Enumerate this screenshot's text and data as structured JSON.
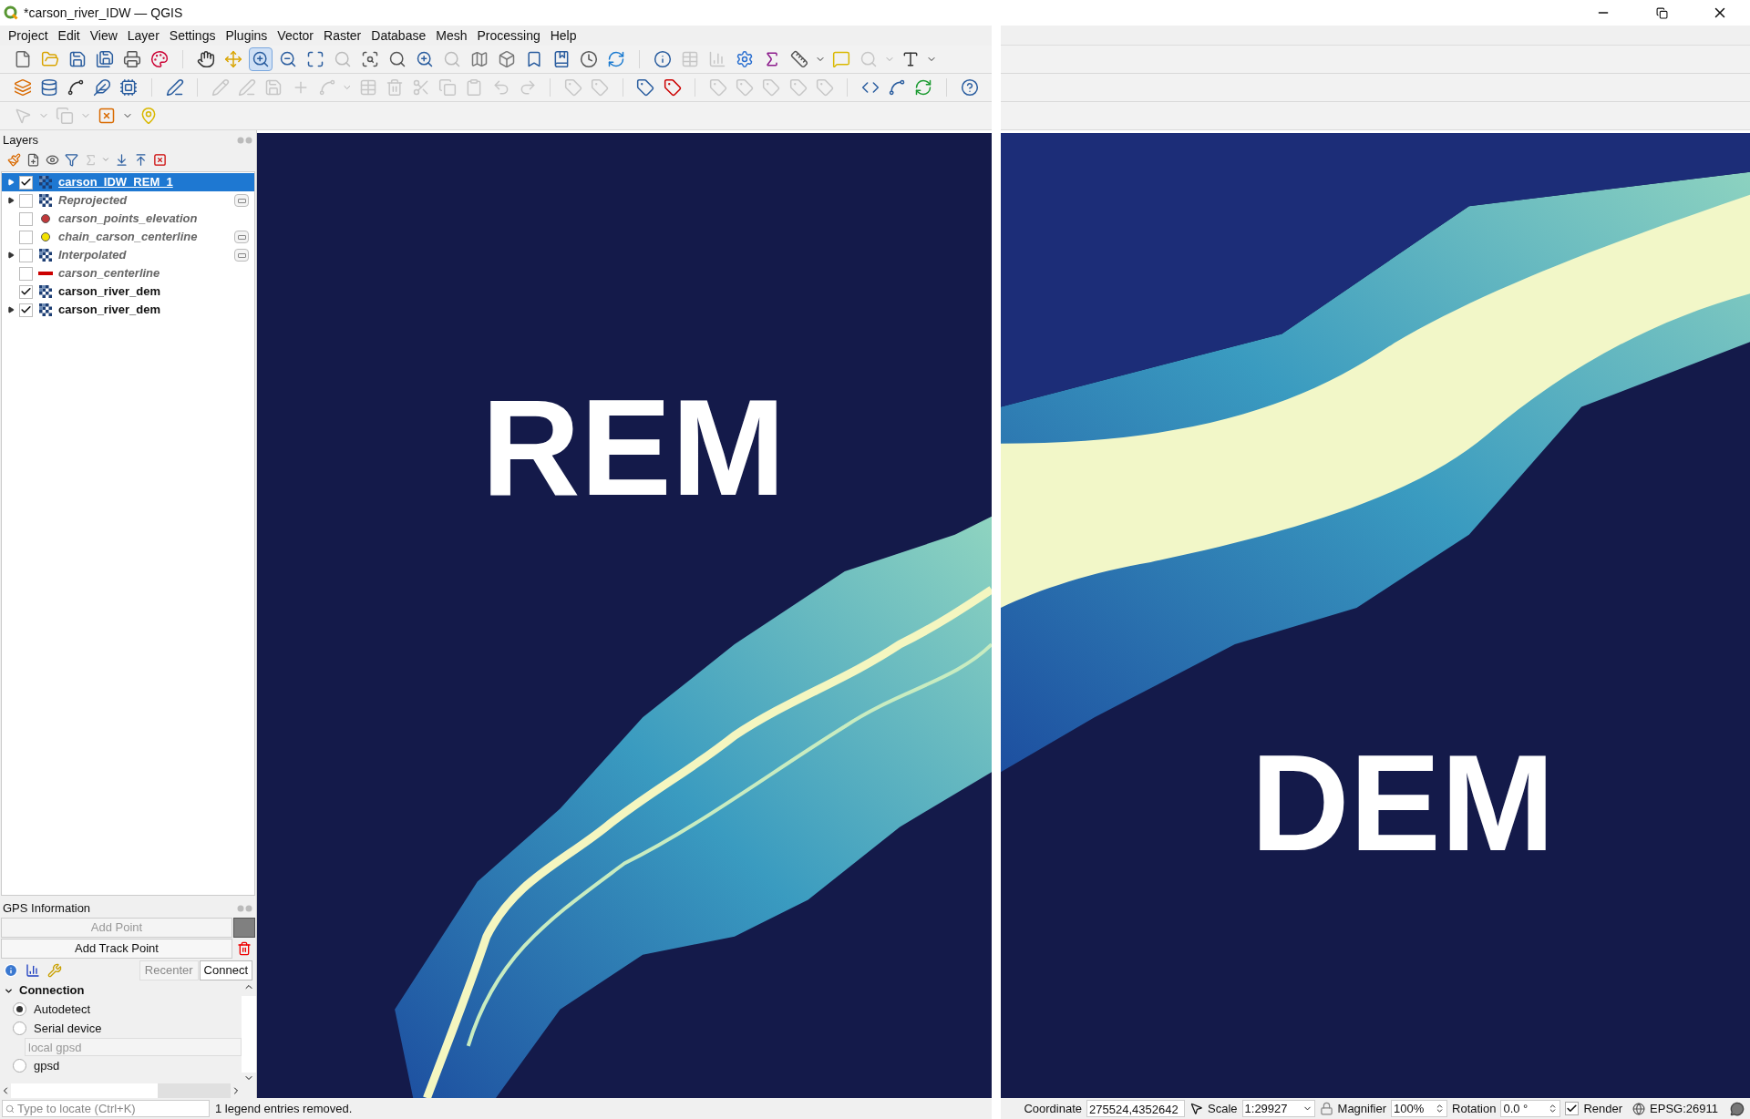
{
  "window": {
    "title": "*carson_river_IDW — QGIS"
  },
  "menu": [
    "Project",
    "Edit",
    "View",
    "Layer",
    "Settings",
    "Plugins",
    "Vector",
    "Raster",
    "Database",
    "Mesh",
    "Processing",
    "Help"
  ],
  "toolbars": [
    [
      {
        "disabled": false,
        "active": false
      },
      {
        "disabled": false,
        "active": false
      },
      {
        "disabled": false,
        "active": false
      },
      {
        "disabled": false,
        "active": false
      },
      {
        "disabled": false,
        "active": false
      },
      {
        "disabled": false,
        "active": false
      },
      {
        "disabled": false,
        "active": false
      },
      {
        "disabled": false,
        "active": false
      },
      {
        "disabled": false,
        "active": true
      },
      {
        "disabled": false,
        "active": false
      },
      {
        "disabled": false,
        "active": false
      },
      {
        "disabled": true,
        "active": false
      },
      {
        "disabled": false,
        "active": false
      },
      {
        "disabled": false,
        "active": false
      },
      {
        "disabled": false,
        "active": false
      },
      {
        "disabled": true,
        "active": false
      },
      {
        "disabled": false,
        "active": false
      },
      {
        "disabled": false,
        "active": false
      },
      {
        "disabled": false,
        "active": false
      },
      {
        "disabled": false,
        "active": false
      },
      {
        "disabled": false,
        "active": false
      },
      {
        "disabled": false,
        "active": false
      },
      {
        "disabled": false,
        "active": false
      },
      {
        "disabled": true,
        "active": false
      },
      {
        "disabled": true,
        "active": false
      },
      {
        "disabled": false,
        "active": false
      },
      {
        "disabled": false,
        "active": false
      },
      {
        "disabled": false,
        "active": false
      },
      {
        "disabled": false,
        "active": false
      },
      {
        "disabled": true,
        "active": false
      },
      {
        "disabled": false,
        "active": false
      }
    ],
    [
      {
        "disabled": false
      },
      {
        "disabled": false
      },
      {
        "disabled": false
      },
      {
        "disabled": false
      },
      {
        "disabled": false
      },
      {
        "disabled": false
      },
      {
        "disabled": true
      },
      {
        "disabled": true
      },
      {
        "disabled": true
      },
      {
        "disabled": true
      },
      {
        "disabled": true
      },
      {
        "disabled": true
      },
      {
        "disabled": true
      },
      {
        "disabled": true
      },
      {
        "disabled": true
      },
      {
        "disabled": true
      },
      {
        "disabled": true
      },
      {
        "disabled": true
      },
      {
        "disabled": true
      },
      {
        "disabled": true
      },
      {
        "disabled": false
      },
      {
        "disabled": false
      },
      {
        "disabled": true
      },
      {
        "disabled": true
      },
      {
        "disabled": true
      },
      {
        "disabled": true
      },
      {
        "disabled": true
      },
      {
        "disabled": false
      },
      {
        "disabled": false
      },
      {
        "disabled": false
      },
      {
        "disabled": false
      }
    ],
    [
      {
        "disabled": true
      },
      {
        "disabled": true
      },
      {
        "disabled": false
      },
      {
        "disabled": false
      }
    ]
  ],
  "layers_panel": {
    "title": "Layers",
    "toolbar": [
      {
        "disabled": false
      },
      {
        "disabled": false
      },
      {
        "disabled": false
      },
      {
        "disabled": false
      },
      {
        "disabled": true
      },
      {
        "disabled": false
      },
      {
        "disabled": false
      },
      {
        "disabled": false
      }
    ],
    "items": [
      {
        "name": "carson_IDW_REM_1",
        "kind": "raster",
        "expandable": true,
        "checked": true,
        "selected": true,
        "emphasized": true,
        "indicator": false
      },
      {
        "name": "Reprojected",
        "kind": "raster",
        "expandable": true,
        "checked": false,
        "selected": false,
        "emphasized": false,
        "indicator": true
      },
      {
        "name": "carson_points_elevation",
        "kind": "point",
        "color": "#c0393b",
        "expandable": false,
        "checked": false,
        "selected": false,
        "emphasized": false,
        "indicator": false
      },
      {
        "name": "chain_carson_centerline",
        "kind": "point",
        "color": "#f2e200",
        "expandable": false,
        "checked": false,
        "selected": false,
        "emphasized": false,
        "indicator": true
      },
      {
        "name": "Interpolated",
        "kind": "raster",
        "expandable": true,
        "checked": false,
        "selected": false,
        "emphasized": false,
        "indicator": true
      },
      {
        "name": "carson_centerline",
        "kind": "line",
        "color": "#cc0000",
        "expandable": false,
        "checked": false,
        "selected": false,
        "emphasized": false,
        "indicator": false
      },
      {
        "name": "carson_river_dem",
        "kind": "raster",
        "expandable": false,
        "checked": true,
        "selected": false,
        "emphasized": true,
        "indicator": false
      },
      {
        "name": "carson_river_dem",
        "kind": "raster",
        "expandable": true,
        "checked": true,
        "selected": false,
        "emphasized": true,
        "indicator": false
      }
    ]
  },
  "gps_panel": {
    "title": "GPS Information",
    "add_point": {
      "label": "Add Point",
      "disabled": true
    },
    "add_track_point": {
      "label": "Add Track Point",
      "disabled": false
    },
    "recenter": {
      "label": "Recenter",
      "disabled": true
    },
    "connect": {
      "label": "Connect",
      "disabled": false
    },
    "section": {
      "label": "Connection",
      "expanded": true
    },
    "options": [
      {
        "label": "Autodetect",
        "selected": true
      },
      {
        "label": "Serial device",
        "selected": false
      }
    ],
    "gpsd_field": {
      "placeholder": "local gpsd"
    },
    "options_2": [
      {
        "label": "gpsd",
        "selected": false
      }
    ]
  },
  "maps": [
    {
      "label": "REM",
      "kind": "rem"
    },
    {
      "label": "DEM",
      "kind": "dem"
    }
  ],
  "status_left": {
    "locator": {
      "placeholder": "Type to locate (Ctrl+K)"
    },
    "message": "1 legend entries removed."
  },
  "status_right": {
    "coordinate_label": "Coordinate",
    "coordinate": "275524,4352642",
    "scale_label": "Scale",
    "scale": "1:29927",
    "magnifier_label": "Magnifier",
    "magnifier": "100%",
    "rotation_label": "Rotation",
    "rotation": "0.0 °",
    "render": {
      "label": "Render",
      "checked": true
    },
    "crs": "EPSG:26911"
  }
}
